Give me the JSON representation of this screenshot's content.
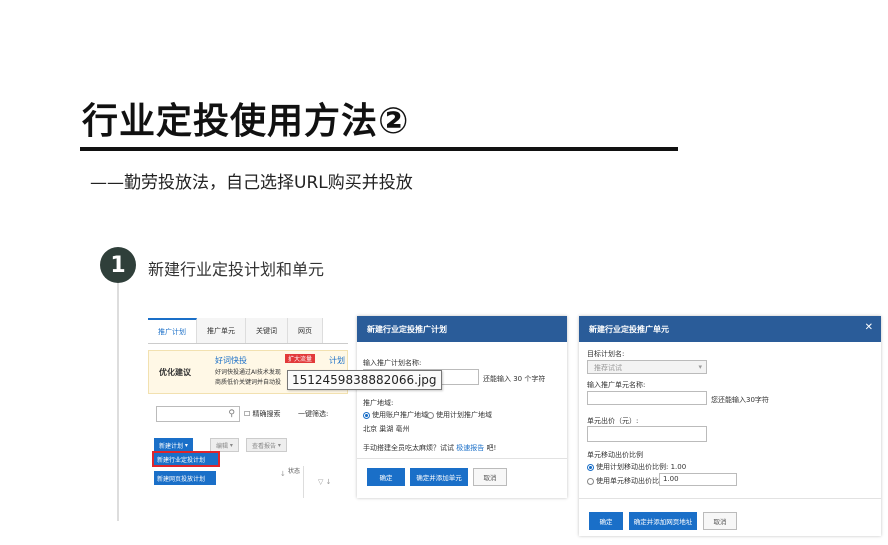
{
  "slide": {
    "title": "行业定投使用方法②",
    "subtitle": "——勤劳投放法，自己选择URL购买并投放",
    "step_number": "1",
    "step_text": "新建行业定投计划和单元"
  },
  "panel_left": {
    "tabs": [
      "推广计划",
      "推广单元",
      "关键词",
      "网页"
    ],
    "opt_label": "优化建议",
    "opt_link": "好词快投",
    "opt_tag": "扩大流量",
    "opt_text1": "好词快投通过AI技术发现",
    "opt_text2": "商质低价关键词并自动投",
    "opt_link2": "计划",
    "search_icon": "search-icon",
    "checkbox_label": "精确搜索",
    "filter_label": "一键筛选:",
    "new_plan": "新建计划",
    "edit": "编辑",
    "view_report": "查看报告",
    "menu_item1": "新建行业定投计划",
    "menu_item2": "新建网页投放计划",
    "status": "状态",
    "sort1": "↓",
    "sort2": "▽ ↓"
  },
  "tooltip": "1512459838882066.jpg",
  "dialog_plan": {
    "header": "新建行业定投推广计划",
    "name_label": "输入推广计划名称:",
    "name_hint": "还能输入 30 个字符",
    "region_label": "推广地域:",
    "radio1": "使用账户推广地域",
    "radio2": "使用计划推广地域",
    "regions": "北京 巢湖 亳州",
    "tip_text": "手动搭建全员吃太麻烦？试试",
    "tip_link": "极速报告",
    "tip_end": "吧!",
    "btn_ok": "确定",
    "btn_ok_add": "确定并添加单元",
    "btn_cancel": "取消"
  },
  "dialog_unit": {
    "header": "新建行业定投推广单元",
    "close_icon": "close-icon",
    "target_label": "目标计划名:",
    "target_value": "推荐试试",
    "name_label": "输入推广单元名称:",
    "name_hint": "您还能输入30字符",
    "price_label": "单元出价（元）:",
    "ratio_label": "单元移动出价比例",
    "radio1": "使用计划移动出价比例:",
    "radio1_val": "1.00",
    "radio2": "使用单元移动出价比例:",
    "radio2_val": "1.00",
    "btn_ok": "确定",
    "btn_ok_add": "确定并添加网页地址",
    "btn_cancel": "取消"
  }
}
